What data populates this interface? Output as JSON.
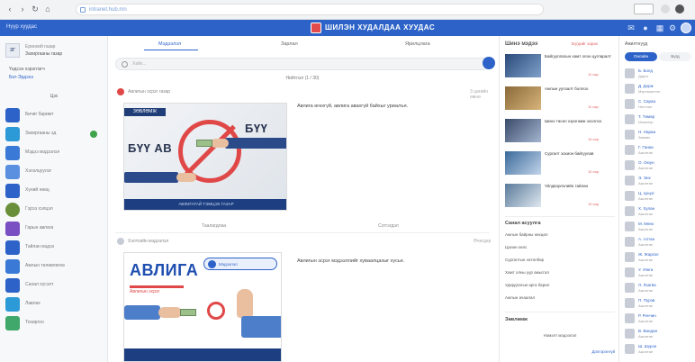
{
  "browser": {
    "url": "intranet.hub.mn"
  },
  "app": {
    "left_label": "Нүүр хуудас",
    "title": "ШИЛЭН ХУДАЛДАА ХУУДАС"
  },
  "sidebar": {
    "org_label": "Ерөнхий газар",
    "org_name": "Захиргааны газар",
    "user_role": "Үндсэн хэрэглэгч",
    "user_name": "Бат-Эрдэнэ",
    "section_title": "Цэс",
    "items": [
      {
        "label": "Бичиг баримт"
      },
      {
        "label": "Захиргааны эд"
      },
      {
        "label": "Мэдээ мэдээлэл"
      },
      {
        "label": "Хэлэлцүүлэг"
      },
      {
        "label": "Хүний нөөц"
      },
      {
        "label": "Гэрээ хэлцэл"
      },
      {
        "label": "Гарын авлага"
      },
      {
        "label": "Тайлан мэдээ"
      },
      {
        "label": "Ажлын төлөвлөгөө"
      },
      {
        "label": "Санал хүсэлт"
      },
      {
        "label": "Лавлах"
      },
      {
        "label": "Тохиргоо"
      }
    ]
  },
  "feed": {
    "tabs": [
      "Мэдээлэл",
      "Зарлал",
      "Ярилцлага"
    ],
    "search_placeholder": "Хайх...",
    "note": "Нийтлэл (1 / 30)",
    "post1": {
      "author": "Авлигын эсрэг газар",
      "text": "Авлига өгөхгүй, авлига авахгүй байхыг уриалъя.",
      "time": "3 цагийн өмнө",
      "like": "Таалагдлаа",
      "comment": "Сэтгэгдэл"
    },
    "post2": {
      "author": "Хэлтсийн мэдээлэл",
      "text": "Авлигын эсрэг мэдээллийг хуваалцахыг хүсье.",
      "time": "Өчигдөр"
    },
    "poster1": {
      "ribbon": "ЗӨВЛӨМЖ",
      "word_left": "БҮҮ АВ",
      "word_right": "БҮҮ ӨГ",
      "footer": "АВЛИГАТАЙ ТЭМЦЭХ ГАЗАР"
    },
    "poster2": {
      "title": "АВЛИГА",
      "subtitle": "Авлигын эсрэг",
      "box": "Мэдээлэл"
    }
  },
  "news": {
    "title": "Шинэ мэдээ",
    "more": "Бүгдийг харах",
    "items": [
      {
        "title": "Байгууллагын хамт олон цугларалт",
        "date": "11 сар"
      },
      {
        "title": "Ажлын уулзалт боллоо",
        "date": "11 сар"
      },
      {
        "title": "Шинэ төсөл хэрэгжиж эхэллээ",
        "date": "10 сар"
      },
      {
        "title": "Сургалт зохион байгуулав",
        "date": "10 сар"
      },
      {
        "title": "Үйлдвэрлэлийн тайлан",
        "date": "10 сар"
      }
    ],
    "list_title": "Санал асуулга",
    "list": [
      "Ажлын байрны нөхцөл",
      "Цалин хөлс",
      "Сургалтын хөтөлбөр",
      "Хамт олны уур амьсгал",
      "Удирдлагын арга барил",
      "Ажлын ачаалал"
    ],
    "list2_title": "Зөвлөмж",
    "list2_text": "Нэмэлт мэдээлэл",
    "list2_more": "Дэлгэрэнгүй"
  },
  "contacts": {
    "title": "Ажилтнууд",
    "tabs": [
      "Онлайн",
      "Бүгд"
    ],
    "people": [
      {
        "name": "Б. Болд",
        "role": "Дарга"
      },
      {
        "name": "Д. Дорж",
        "role": "Мэргэжилтэн"
      },
      {
        "name": "С. Сараа",
        "role": "Нягтлан"
      },
      {
        "name": "Т. Төмөр",
        "role": "Инженер"
      },
      {
        "name": "Н. Нараа",
        "role": "Зөвлөх"
      },
      {
        "name": "Г. Ганаа",
        "role": "Ажилтан"
      },
      {
        "name": "О. Оюун",
        "role": "Ажилтан"
      },
      {
        "name": "Э. Энх",
        "role": "Ажилтан"
      },
      {
        "name": "Ц. Цэцэг",
        "role": "Ажилтан"
      },
      {
        "name": "Х. Хулан",
        "role": "Ажилтан"
      },
      {
        "name": "М. Мөнх",
        "role": "Ажилтан"
      },
      {
        "name": "А. Алтан",
        "role": "Ажилтан"
      },
      {
        "name": "Ж. Жаргал",
        "role": "Ажилтан"
      },
      {
        "name": "У. Уянга",
        "role": "Ажилтан"
      },
      {
        "name": "Л. Лхагва",
        "role": "Ажилтан"
      },
      {
        "name": "П. Пүрэв",
        "role": "Ажилтан"
      },
      {
        "name": "Р. Ренчин",
        "role": "Ажилтан"
      },
      {
        "name": "В. Вандан",
        "role": "Ажилтан"
      },
      {
        "name": "Ш. Шүрэн",
        "role": "Ажилтан"
      }
    ]
  }
}
